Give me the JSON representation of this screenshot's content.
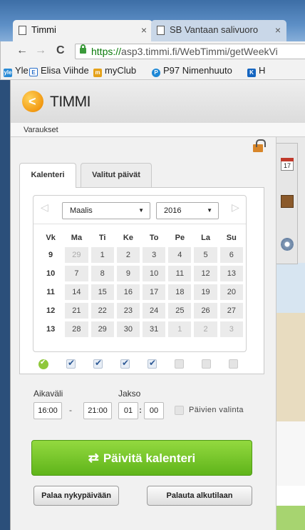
{
  "browser": {
    "tabs": [
      {
        "title": "Timmi",
        "close": "×"
      },
      {
        "title": "SB Vantaan salivuoro",
        "close": "×"
      }
    ],
    "nav": {
      "back": "←",
      "forward": "→",
      "reload": "C"
    },
    "url": {
      "protocol": "https://",
      "rest": "asp3.timmi.fi/WebTimmi/getWeekVi"
    },
    "bookmarks": [
      {
        "icon": "yle",
        "label": "Yle"
      },
      {
        "icon": "E",
        "label": "Elisa Viihde"
      },
      {
        "icon": "m",
        "label": "myClub"
      },
      {
        "icon": "P",
        "label": "P97 Nimenhuuto"
      },
      {
        "icon": "K",
        "label": "H"
      }
    ]
  },
  "app": {
    "logo_glyph": "<",
    "logo_text": "TIMMI",
    "menu": "Varaukset",
    "tabs": [
      "Kalenteri",
      "Valitut päivät"
    ],
    "calendar": {
      "prev": "◁",
      "next": "▷",
      "month": "Maalis",
      "year": "2016",
      "caret": "▼",
      "headers": [
        "Vk",
        "Ma",
        "Ti",
        "Ke",
        "To",
        "Pe",
        "La",
        "Su"
      ],
      "weeks": [
        {
          "wk": "9",
          "days": [
            "29",
            "1",
            "2",
            "3",
            "4",
            "5",
            "6"
          ]
        },
        {
          "wk": "10",
          "days": [
            "7",
            "8",
            "9",
            "10",
            "11",
            "12",
            "13"
          ]
        },
        {
          "wk": "11",
          "days": [
            "14",
            "15",
            "16",
            "17",
            "18",
            "19",
            "20"
          ]
        },
        {
          "wk": "12",
          "days": [
            "21",
            "22",
            "23",
            "24",
            "25",
            "26",
            "27"
          ]
        },
        {
          "wk": "13",
          "days": [
            "28",
            "29",
            "30",
            "31",
            "1",
            "2",
            "3"
          ]
        }
      ],
      "weekday_checks": [
        true,
        true,
        true,
        true,
        false,
        false,
        false
      ]
    },
    "time": {
      "aikavali_label": "Aikaväli",
      "jakso_label": "Jakso",
      "start": "16:00",
      "dash": "-",
      "end": "21:00",
      "jakso_h": "01",
      "colon": ":",
      "jakso_m": "00",
      "paivien_valinta": "Päivien valinta"
    },
    "update_button": "Päivitä kalenteri",
    "swap_glyph": "⇄",
    "btn_today": "Palaa nykypäivään",
    "btn_reset": "Palauta alkutilaan",
    "cal_icon_day": "17"
  }
}
